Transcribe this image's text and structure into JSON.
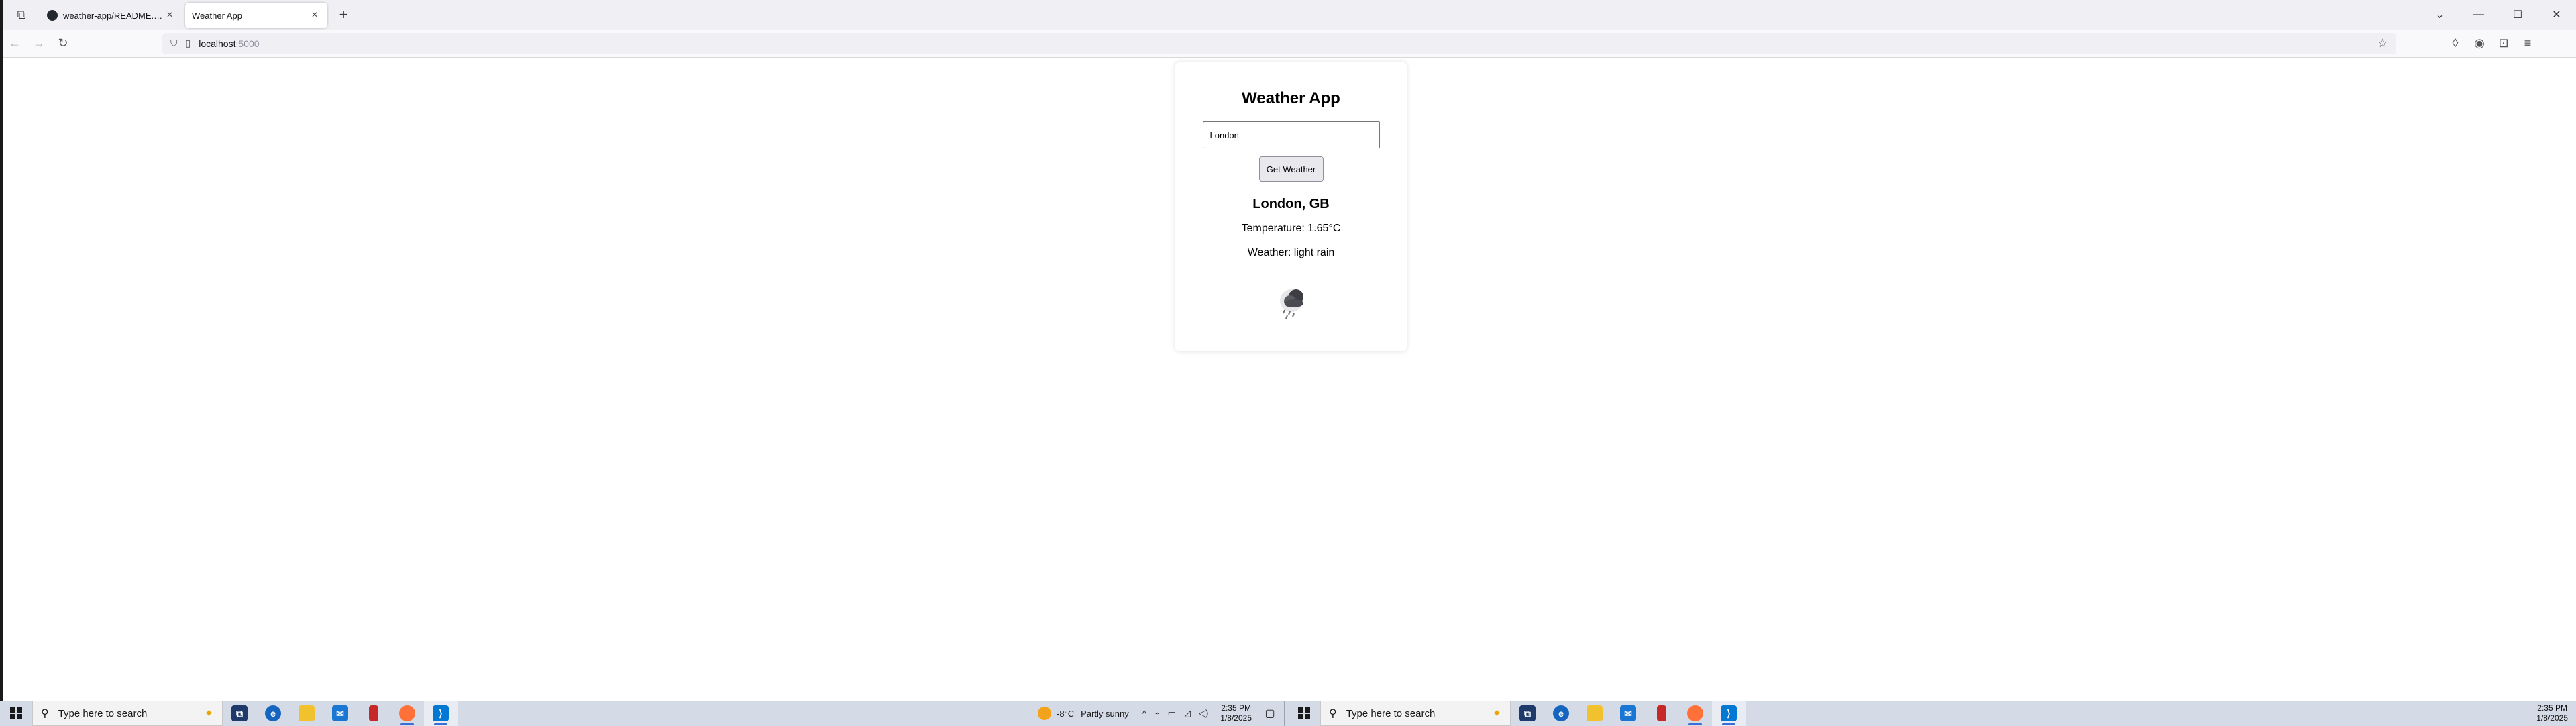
{
  "browser": {
    "tabs": [
      {
        "title": "weather-app/README.md at m",
        "active": false
      },
      {
        "title": "Weather App",
        "active": true
      }
    ],
    "new_tab_label": "+",
    "url_host": "localhost",
    "url_port": ":5000"
  },
  "app": {
    "title": "Weather App",
    "city_input_value": "London",
    "get_button_label": "Get Weather",
    "location": "London, GB",
    "temperature": "Temperature: 1.65°C",
    "weather": "Weather: light rain",
    "weather_icon": "light-rain-cloud-icon"
  },
  "taskbar_left": {
    "search_placeholder": "Type here to search",
    "weather_temp": "-8°C",
    "weather_desc": "Partly sunny",
    "time": "2:35 PM",
    "date": "1/8/2025"
  },
  "taskbar_right": {
    "search_placeholder": "Type here to search",
    "time": "2:35 PM",
    "date": "1/8/2025"
  },
  "colors": {
    "taskbar_bg": "#d4dbe6",
    "edge_app": "#1565c0",
    "vscode": "#0078d4",
    "firefox": "#ff7139"
  }
}
